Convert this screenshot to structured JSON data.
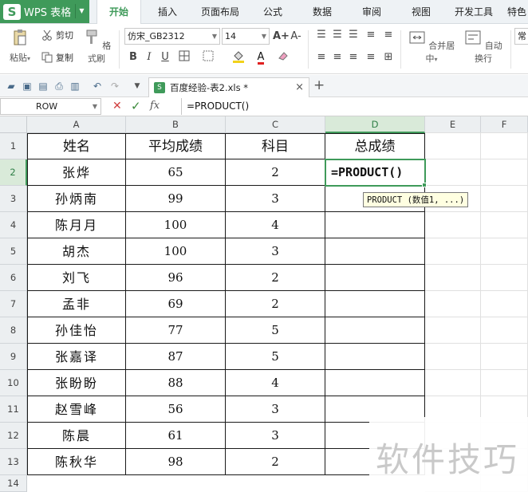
{
  "app": {
    "brand": "WPS 表格",
    "logo_letter": "S",
    "accent_color": "#3f9a5a"
  },
  "ribbon_tabs": [
    {
      "label": "开始",
      "active": true
    },
    {
      "label": "插入"
    },
    {
      "label": "页面布局"
    },
    {
      "label": "公式"
    },
    {
      "label": "数据"
    },
    {
      "label": "审阅"
    },
    {
      "label": "视图"
    },
    {
      "label": "开发工具"
    },
    {
      "label": "特色"
    }
  ],
  "toolbar": {
    "paste_label": "粘贴",
    "cut_label": "剪切",
    "copy_label": "复制",
    "format_painter_label": "格式刷",
    "font_name": "仿宋_GB2312",
    "font_size": "14",
    "bold": "B",
    "italic": "I",
    "underline": "U",
    "merge_center_label": "合并居中",
    "wrap_text_label": "自动换行",
    "font_color_glyph": "A",
    "increase_font_glyph": "A+",
    "decrease_font_glyph": "A-",
    "style_label": "常"
  },
  "document_tab": {
    "name": "百度经验-表2.xls *",
    "close_glyph": "×",
    "new_tab_glyph": "+"
  },
  "formula_bar": {
    "name_box": "ROW",
    "cancel_glyph": "✕",
    "confirm_glyph": "✓",
    "fx_label": "fx",
    "formula": "=PRODUCT()"
  },
  "sheet": {
    "columns": [
      "A",
      "B",
      "C",
      "D",
      "E",
      "F"
    ],
    "selected_column": "D",
    "selected_row": "2",
    "header_row": [
      "姓名",
      "平均成绩",
      "科目",
      "总成绩"
    ],
    "rows": [
      {
        "row": "2",
        "name": "张烨",
        "avg": "65",
        "subjects": "2"
      },
      {
        "row": "3",
        "name": "孙炳南",
        "avg": "99",
        "subjects": "3"
      },
      {
        "row": "4",
        "name": "陈月月",
        "avg": "100",
        "subjects": "4"
      },
      {
        "row": "5",
        "name": "胡杰",
        "avg": "100",
        "subjects": "3"
      },
      {
        "row": "6",
        "name": "刘飞",
        "avg": "96",
        "subjects": "2"
      },
      {
        "row": "7",
        "name": "孟非",
        "avg": "69",
        "subjects": "2"
      },
      {
        "row": "8",
        "name": "孙佳怡",
        "avg": "77",
        "subjects": "5"
      },
      {
        "row": "9",
        "name": "张嘉译",
        "avg": "87",
        "subjects": "5"
      },
      {
        "row": "10",
        "name": "张盼盼",
        "avg": "88",
        "subjects": "4"
      },
      {
        "row": "11",
        "name": "赵雪峰",
        "avg": "56",
        "subjects": "3"
      },
      {
        "row": "12",
        "name": "陈晨",
        "avg": "61",
        "subjects": "3"
      },
      {
        "row": "13",
        "name": "陈秋华",
        "avg": "98",
        "subjects": "2"
      }
    ],
    "row_numbers": [
      "1",
      "2",
      "3",
      "4",
      "5",
      "6",
      "7",
      "8",
      "9",
      "10",
      "11",
      "12",
      "13",
      "14"
    ],
    "active_cell_value": "=PRODUCT()",
    "tooltip": "PRODUCT (数值1, ...)"
  },
  "watermark": "软件技巧"
}
